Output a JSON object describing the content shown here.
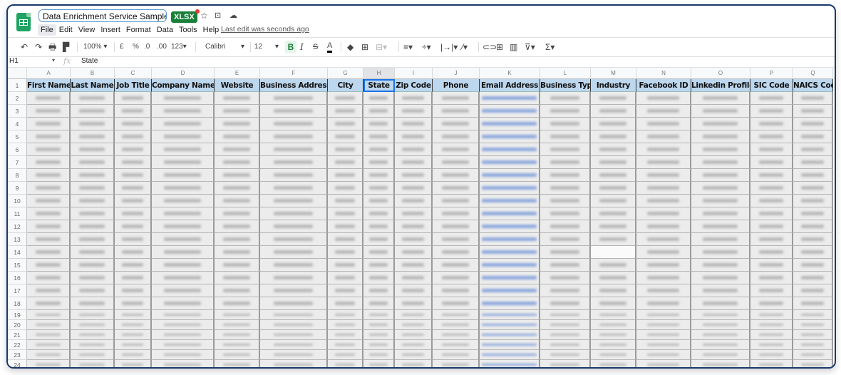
{
  "app": {
    "doc_title": "Data Enrichment Service Sample...",
    "file_badge": "XLSX",
    "title_icons": [
      "star-icon",
      "move-to-folder-icon",
      "cloud-status-icon"
    ],
    "menu": [
      "File",
      "Edit",
      "View",
      "Insert",
      "Format",
      "Data",
      "Tools",
      "Help"
    ],
    "last_edit": "Last edit was seconds ago"
  },
  "toolbar": {
    "zoom": "100%",
    "currency": "£",
    "percent": "%",
    "decrease_decimal": ".0",
    "increase_decimal": ".00",
    "number_format": "123",
    "font": "Calibri",
    "font_size": "12",
    "bold": "B",
    "italic": "I",
    "strike": "S",
    "text_color": "A"
  },
  "formula_bar": {
    "cell_ref": "H1",
    "fx": "fx",
    "value": "State"
  },
  "sheet": {
    "column_letters": [
      "A",
      "B",
      "C",
      "D",
      "E",
      "F",
      "G",
      "H",
      "I",
      "J",
      "K",
      "L",
      "M",
      "N",
      "O",
      "P",
      "Q"
    ],
    "headers": [
      "First Name",
      "Last Name",
      "Job Title",
      "Company Name",
      "Website",
      "Business Address",
      "City",
      "State",
      "Zip Code",
      "Phone",
      "Email Address",
      "Business Type",
      "Industry",
      "Facebook ID",
      "Linkedin Profile",
      "SIC Code",
      "NAICS Code"
    ],
    "row_numbers": [
      "1",
      "2",
      "3",
      "4",
      "5",
      "6",
      "7",
      "8",
      "9",
      "10",
      "11",
      "12",
      "13",
      "14",
      "15",
      "16",
      "17",
      "18",
      "19",
      "20",
      "21",
      "22",
      "23",
      "24"
    ],
    "selected_cell": "H1",
    "cell_values_visible": false,
    "colors": {
      "header_fill": "#bdd7ee",
      "selection": "#1a73e8",
      "link_text": "#4a74c9"
    }
  }
}
